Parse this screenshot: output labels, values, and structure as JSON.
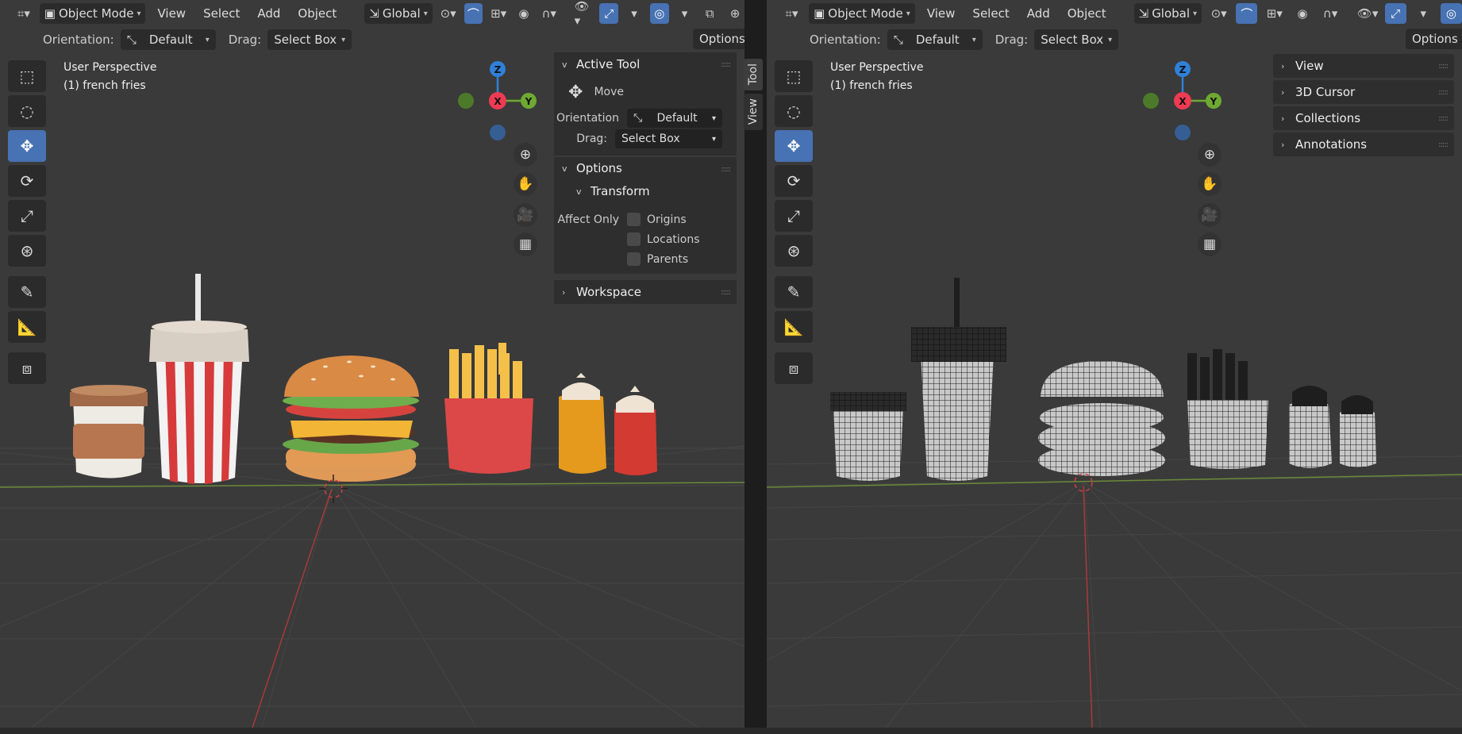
{
  "left": {
    "header": {
      "mode_label": "Object Mode",
      "menu": [
        "View",
        "Select",
        "Add",
        "Object"
      ],
      "transform_label": "Global"
    },
    "subheader": {
      "orientation_label": "Orientation:",
      "orientation_value": "Default",
      "drag_label": "Drag:",
      "drag_value": "Select Box",
      "options_label": "Options"
    },
    "viewport": {
      "perspective": "User Perspective",
      "active_object": "(1) french fries"
    },
    "gizmo": {
      "z": "Z",
      "x": "X",
      "y": "Y"
    },
    "sidebar": {
      "active_tool": {
        "title": "Active Tool",
        "tool_name": "Move",
        "orientation_label": "Orientation",
        "orientation_value": "Default",
        "drag_label": "Drag:",
        "drag_value": "Select Box"
      },
      "options": {
        "title": "Options",
        "transform_title": "Transform",
        "affect_only_label": "Affect Only",
        "checkboxes": [
          "Origins",
          "Locations",
          "Parents"
        ]
      },
      "workspace_title": "Workspace",
      "tabs": [
        "Tool",
        "View"
      ]
    }
  },
  "right": {
    "header": {
      "mode_label": "Object Mode",
      "menu": [
        "View",
        "Select",
        "Add",
        "Object"
      ],
      "transform_label": "Global"
    },
    "subheader": {
      "orientation_label": "Orientation:",
      "orientation_value": "Default",
      "drag_label": "Drag:",
      "drag_value": "Select Box",
      "options_label": "Options"
    },
    "viewport": {
      "perspective": "User Perspective",
      "active_object": "(1) french fries"
    },
    "gizmo": {
      "z": "Z",
      "x": "X",
      "y": "Y"
    },
    "sidebar_panels": [
      "View",
      "3D Cursor",
      "Collections",
      "Annotations"
    ]
  },
  "colors": {
    "accent": "#4772b3",
    "axis_x": "#ee3a52",
    "axis_y": "#6ea932",
    "axis_z": "#2f80d8"
  }
}
